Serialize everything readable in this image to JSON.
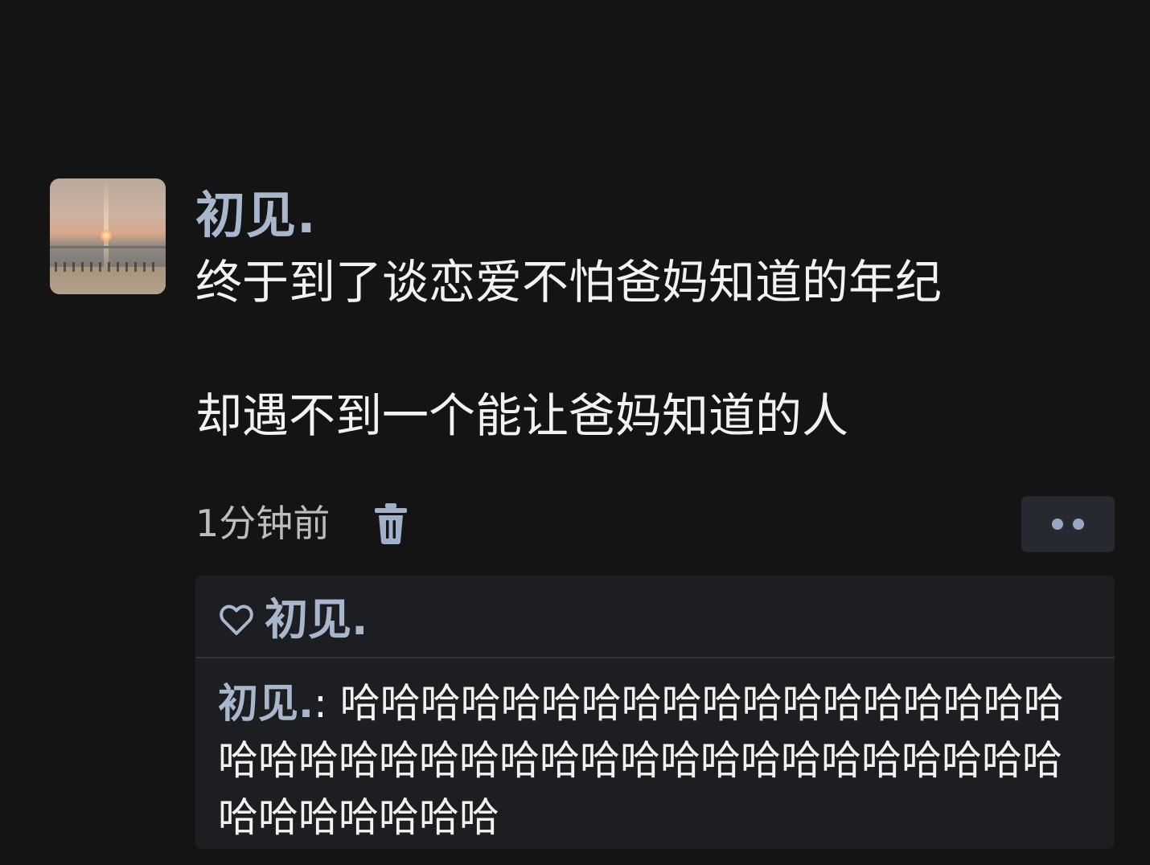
{
  "post": {
    "author": "初见.",
    "content_lines": [
      "终于到了谈恋爱不怕爸妈知道的年纪",
      "却遇不到一个能让爸妈知道的人"
    ],
    "time": "1分钟前"
  },
  "interactions": {
    "likes": [
      "初见."
    ],
    "comments": [
      {
        "author": "初见.",
        "separator": ": ",
        "text": "哈哈哈哈哈哈哈哈哈哈哈哈哈哈哈哈哈哈哈哈哈哈哈哈哈哈哈哈哈哈哈哈哈哈哈哈哈哈哈哈哈哈哈哈哈哈"
      }
    ]
  },
  "icons": {
    "delete": "trash-icon",
    "more": "more-dots-icon",
    "like": "heart-icon"
  },
  "colors": {
    "background": "#141414",
    "name": "#a9b7cd",
    "text": "#f2f2f2",
    "meta": "#bdbdbd",
    "panel": "#1c1e21",
    "button": "#262a30"
  }
}
